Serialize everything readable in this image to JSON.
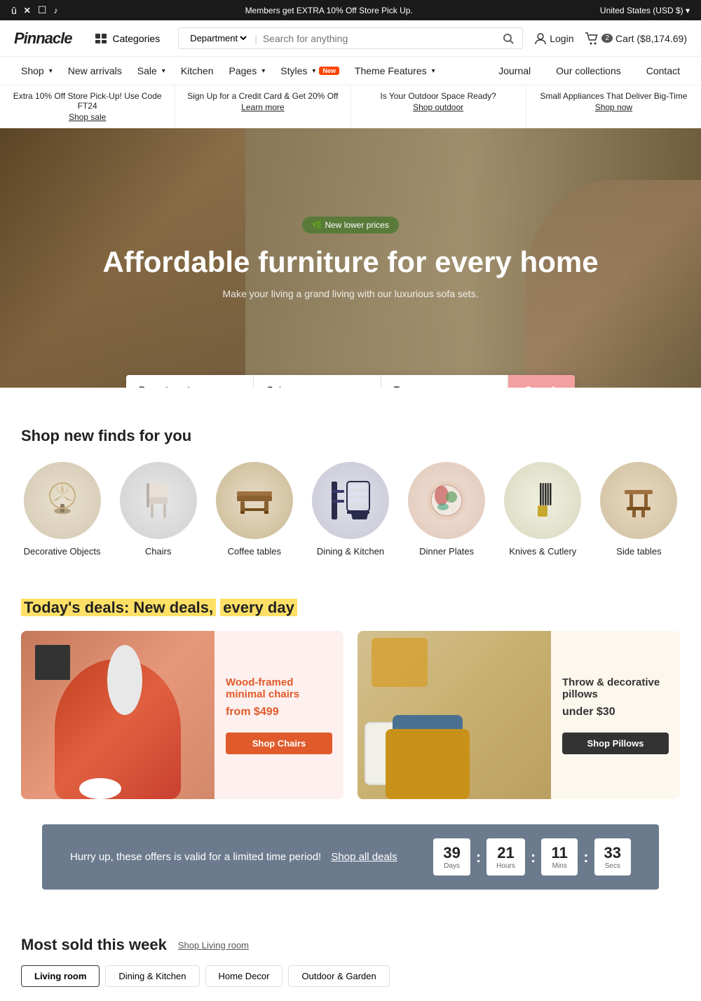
{
  "top_bar": {
    "promo_text": "Members get EXTRA 10% Off Store Pick Up.",
    "region": "United States (USD $)",
    "social_icons": [
      "facebook",
      "x-twitter",
      "instagram",
      "tiktok"
    ]
  },
  "header": {
    "logo": "Pinnacle",
    "categories_label": "Categories",
    "search_placeholder": "Search for anything",
    "login_label": "Login",
    "cart_label": "Cart ($8,174.69)",
    "cart_count": "2"
  },
  "nav": {
    "left_items": [
      {
        "label": "Shop",
        "has_dropdown": true
      },
      {
        "label": "New arrivals",
        "has_dropdown": false
      },
      {
        "label": "Sale",
        "has_dropdown": true
      },
      {
        "label": "Kitchen",
        "has_dropdown": false
      },
      {
        "label": "Pages",
        "has_dropdown": true
      },
      {
        "label": "Styles",
        "has_dropdown": true,
        "badge": "New"
      },
      {
        "label": "Theme Features",
        "has_dropdown": true
      }
    ],
    "right_items": [
      {
        "label": "Journal"
      },
      {
        "label": "Our collections"
      },
      {
        "label": "Contact"
      }
    ]
  },
  "promo_strip": [
    {
      "text": "Extra 10% Off Store Pick-Up! Use Code FT24",
      "link_text": "Shop sale"
    },
    {
      "text": "Sign Up for a Credit Card & Get 20% Off",
      "link_text": "Learn more"
    },
    {
      "text": "Is Your Outdoor Space Ready?",
      "link_text": "Shop outdoor"
    },
    {
      "text": "Small Appliances That Deliver Big-Time",
      "link_text": "Shop now"
    }
  ],
  "hero": {
    "badge": "New lower prices",
    "title": "Affordable furniture for every home",
    "subtitle": "Make your living a grand living with our luxurious sofa sets."
  },
  "search_filter": {
    "department_label": "Department",
    "department_placeholder": "Department",
    "category_label": "Category",
    "category_placeholder": "Category",
    "type_label": "Type",
    "type_placeholder": "Type",
    "search_button": "Search"
  },
  "shop_section": {
    "title": "Shop new finds for you",
    "categories": [
      {
        "label": "Decorative Objects",
        "icon": "decorative"
      },
      {
        "label": "Chairs",
        "icon": "chair"
      },
      {
        "label": "Coffee tables",
        "icon": "coffee-table"
      },
      {
        "label": "Dining & Kitchen",
        "icon": "dining"
      },
      {
        "label": "Dinner Plates",
        "icon": "plates"
      },
      {
        "label": "Knives & Cutlery",
        "icon": "knives"
      },
      {
        "label": "Side tables",
        "icon": "side-table"
      }
    ]
  },
  "deals_section": {
    "title": "Today's deals: New deals,",
    "title_highlight": "every day",
    "cards": [
      {
        "name": "Wood-framed minimal chairs",
        "price": "from $499",
        "button_label": "Shop Chairs",
        "button_style": "red"
      },
      {
        "name": "Throw & decorative pillows",
        "price": "under $30",
        "button_label": "Shop Pillows",
        "button_style": "dark"
      }
    ]
  },
  "countdown": {
    "text": "Hurry up, these offers is valid for a limited time period!",
    "link": "Shop all deals",
    "timer": {
      "days": "39",
      "hours": "21",
      "mins": "11",
      "secs": "33",
      "days_label": "Days",
      "hours_label": "Hours",
      "mins_label": "Mins",
      "secs_label": "Secs"
    }
  },
  "most_sold": {
    "title": "Most sold this week",
    "link": "Shop Living room",
    "tabs": [
      {
        "label": "Living room",
        "active": true
      },
      {
        "label": "Dining & Kitchen",
        "active": false
      },
      {
        "label": "Home Decor",
        "active": false
      },
      {
        "label": "Outdoor & Garden",
        "active": false
      }
    ]
  }
}
